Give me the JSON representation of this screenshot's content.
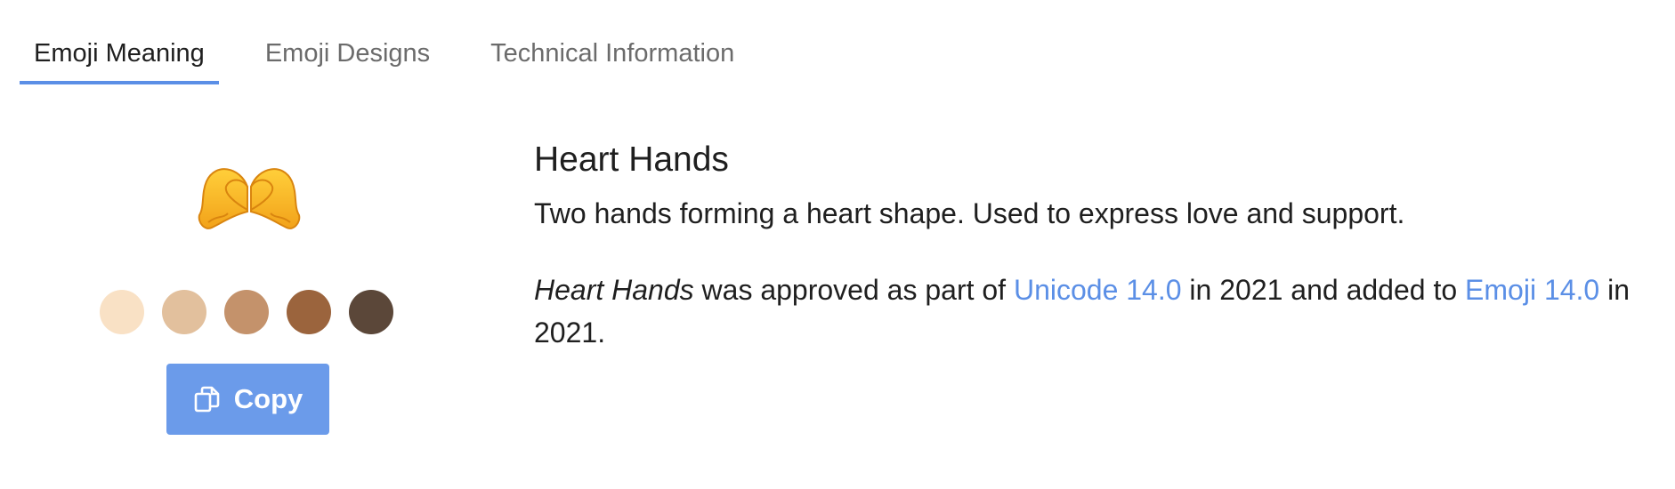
{
  "tabs": [
    {
      "label": "Emoji Meaning",
      "active": true
    },
    {
      "label": "Emoji Designs",
      "active": false
    },
    {
      "label": "Technical Information",
      "active": false
    }
  ],
  "emoji": {
    "glyph": "heart-hands-icon",
    "name": "Heart Hands",
    "description": "Two hands forming a heart shape. Used to express love and support.",
    "approval": {
      "name_italic": "Heart Hands",
      "text_1": " was approved as part of ",
      "unicode_link": "Unicode 14.0",
      "text_2": " in 2021 and added to ",
      "emoji_link": "Emoji 14.0",
      "text_3": " in 2021."
    }
  },
  "skin_tones": [
    {
      "color": "#f9e1c5"
    },
    {
      "color": "#e2c09d"
    },
    {
      "color": "#c4926b"
    },
    {
      "color": "#9b643d"
    },
    {
      "color": "#5b4739"
    }
  ],
  "copy_button": {
    "label": "Copy",
    "icon": "copy-icon"
  },
  "colors": {
    "accent": "#5b8fe6",
    "button": "#6b9bea"
  }
}
